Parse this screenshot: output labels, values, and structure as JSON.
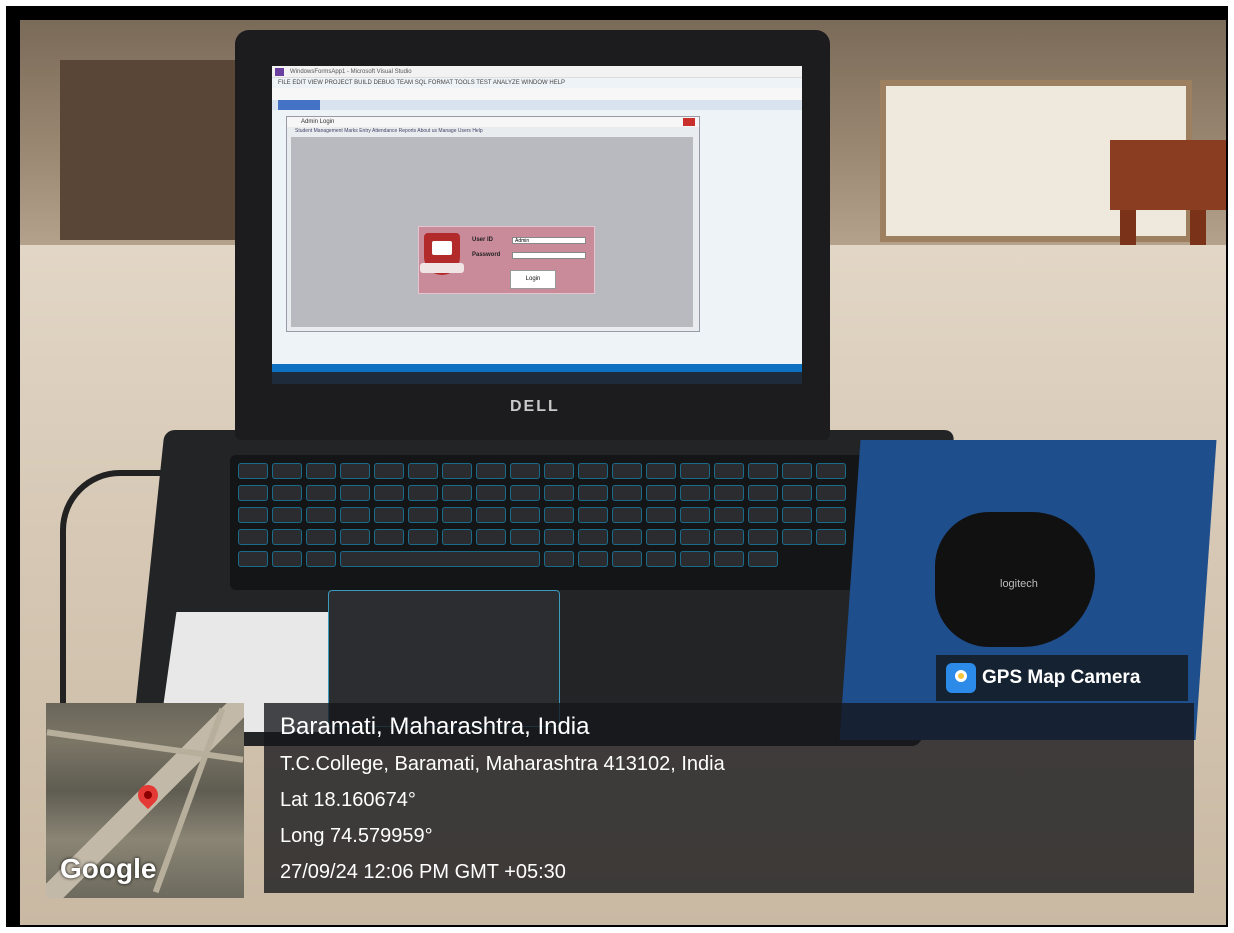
{
  "app": {
    "vs_title": "WindowsFormsApp1 - Microsoft Visual Studio",
    "vs_menu": "FILE  EDIT  VIEW  PROJECT  BUILD  DEBUG  TEAM  SQL  FORMAT  TOOLS  TEST  ANALYZE  WINDOW  HELP",
    "form_title": "Admin Login",
    "form_menu": "Student Management   Marks Entry   Attendance   Reports   About us   Manage Users   Help",
    "user_id_label": "User ID",
    "user_id_value": "Admin",
    "password_label": "Password",
    "password_value": "",
    "login_button": "Login"
  },
  "device": {
    "laptop_brand": "DELL",
    "mouse_brand": "logitech"
  },
  "gps_badge": {
    "label": "GPS Map Camera",
    "icon": "map-camera-icon"
  },
  "location": {
    "city_line": "Baramati, Maharashtra, India",
    "address": "T.C.College, Baramati, Maharashtra 413102, India",
    "lat": "Lat 18.160674°",
    "long": "Long 74.579959°",
    "datetime": "27/09/24 12:06 PM GMT +05:30"
  },
  "map": {
    "provider": "Google",
    "pin_icon": "location-pin-icon"
  },
  "colors": {
    "login_panel": "#c98a9a",
    "crest": "#b32a2a",
    "mousepad": "#1e4e8c",
    "overlay": "#14161a"
  }
}
